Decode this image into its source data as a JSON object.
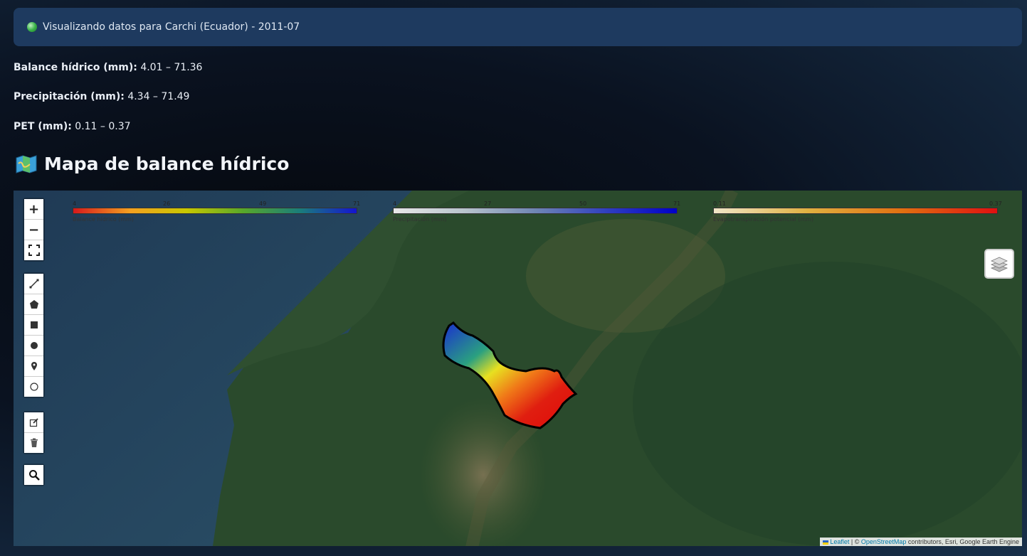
{
  "banner": {
    "text": "Visualizando datos para Carchi (Ecuador) - 2011-07"
  },
  "stats": [
    {
      "label": "Balance hídrico (mm):",
      "value": "4.01 – 71.36"
    },
    {
      "label": "Precipitación (mm):",
      "value": "4.34 – 71.49"
    },
    {
      "label": "PET (mm):",
      "value": "0.11 – 0.37"
    }
  ],
  "heading": {
    "icon": "map-icon",
    "text": "Mapa de balance hídrico"
  },
  "legends": [
    {
      "caption": "Balance hídrico (mm)",
      "ticks": [
        "4",
        "26",
        "49",
        "71"
      ],
      "colors": [
        "#d7191c",
        "#f4a020",
        "#c8c800",
        "#57a82a",
        "#1a7d7a",
        "#1414d0"
      ]
    },
    {
      "caption": "Precipitación (mm)",
      "ticks": [
        "4",
        "27",
        "50",
        "71"
      ],
      "colors": [
        "#e8e8e8",
        "#b8c4cc",
        "#6f86b4",
        "#3040c0",
        "#0000c8"
      ]
    },
    {
      "caption": "Evapotranspiración potencial (mm)",
      "ticks": [
        "0.11",
        "0.37"
      ],
      "colors": [
        "#f0e6c8",
        "#e0b040",
        "#e07010",
        "#e01010"
      ]
    }
  ],
  "zoom_controls": {
    "zoom_in": "+",
    "zoom_out": "−"
  },
  "attribution": {
    "leaflet": "Leaflet",
    "sep": " | © ",
    "osm": "OpenStreetMap",
    "rest": " contributors, Esri, Google Earth Engine"
  }
}
